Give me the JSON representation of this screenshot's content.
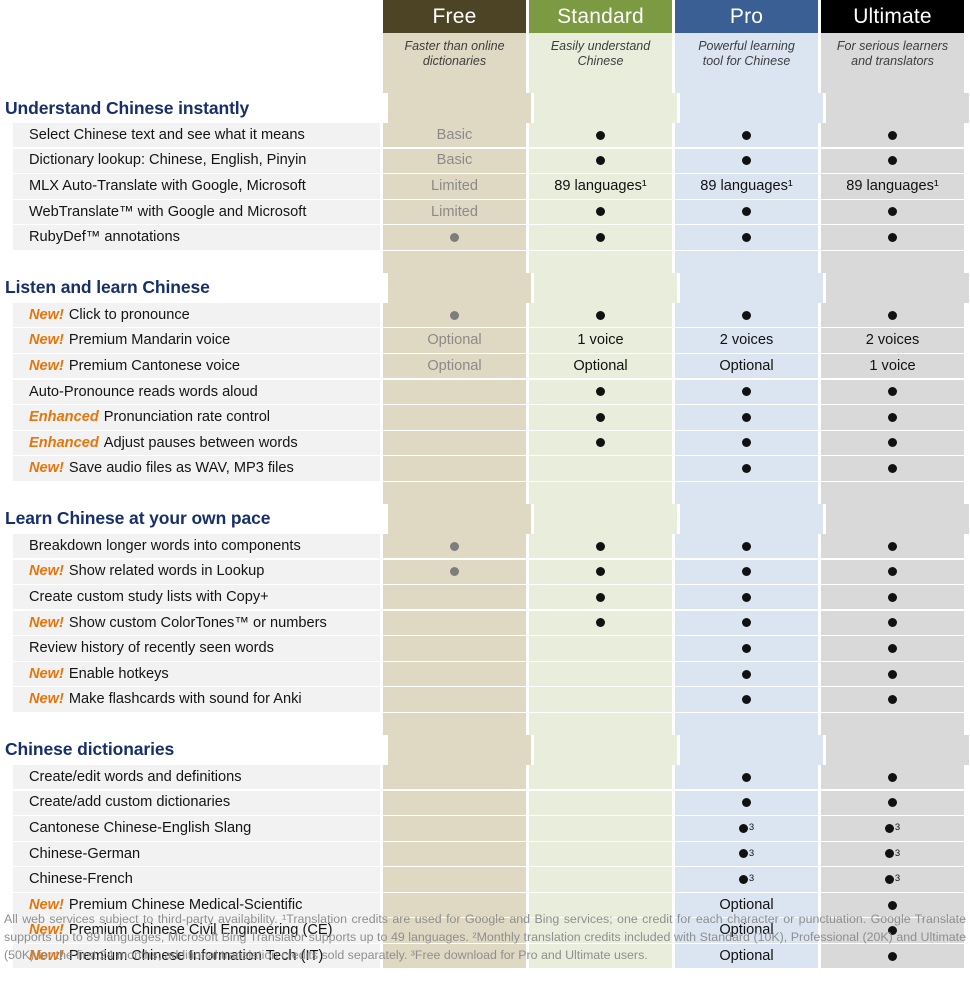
{
  "colors": {
    "free_header": "#4c4425",
    "free_body": "#dfd9c3",
    "standard_header": "#7c9a41",
    "standard_body": "#e9eedc",
    "pro_header": "#3a5f94",
    "pro_body": "#dbe5f1",
    "ultimate_header": "#000000",
    "ultimate_body": "#d9d9d9",
    "section_title": "#17306b",
    "tag_orange": "#e8740c",
    "label_row": "#f2f2f2",
    "dot_dark": "#111111",
    "dot_grey": "#7d7d7d"
  },
  "plans": [
    {
      "name": "Free",
      "tagline_1": "Faster than online",
      "tagline_2": "dictionaries"
    },
    {
      "name": "Standard",
      "tagline_1": "Easily understand",
      "tagline_2": "Chinese"
    },
    {
      "name": "Pro",
      "tagline_1": "Powerful learning",
      "tagline_2": "tool for Chinese"
    },
    {
      "name": "Ultimate",
      "tagline_1": "For serious learners",
      "tagline_2": "and translators"
    }
  ],
  "sections": [
    {
      "title": "Understand Chinese instantly",
      "rows": [
        {
          "tag": "",
          "label": "Select Chinese text and see what it means",
          "values": [
            "Basic",
            "dot",
            "dot",
            "dot"
          ]
        },
        {
          "tag": "",
          "label": "Dictionary lookup: Chinese, English, Pinyin",
          "values": [
            "Basic",
            "dot",
            "dot",
            "dot"
          ]
        },
        {
          "tag": "",
          "label": "MLX Auto-Translate with Google, Microsoft",
          "values": [
            "Limited",
            "89 languages¹",
            "89 languages¹",
            "89 languages¹"
          ]
        },
        {
          "tag": "",
          "label": "WebTranslate™ with Google and Microsoft",
          "values": [
            "Limited",
            "dot",
            "dot",
            "dot"
          ]
        },
        {
          "tag": "",
          "label": "RubyDef™ annotations",
          "values": [
            "dot-grey",
            "dot",
            "dot",
            "dot"
          ]
        }
      ]
    },
    {
      "title": "Listen and learn Chinese",
      "rows": [
        {
          "tag": "New!",
          "label": "Click to pronounce",
          "values": [
            "dot-grey",
            "dot",
            "dot",
            "dot"
          ]
        },
        {
          "tag": "New!",
          "label": "Premium Mandarin voice",
          "values": [
            "Optional",
            "1 voice",
            "2 voices",
            "2 voices"
          ]
        },
        {
          "tag": "New!",
          "label": "Premium Cantonese voice",
          "values": [
            "Optional",
            "Optional",
            "Optional",
            "1 voice"
          ]
        },
        {
          "tag": "",
          "label": "Auto-Pronounce reads words aloud",
          "values": [
            "",
            "dot",
            "dot",
            "dot"
          ]
        },
        {
          "tag": "Enhanced",
          "label": "Pronunciation rate control",
          "values": [
            "",
            "dot",
            "dot",
            "dot"
          ]
        },
        {
          "tag": "Enhanced",
          "label": "Adjust pauses between words",
          "values": [
            "",
            "dot",
            "dot",
            "dot"
          ]
        },
        {
          "tag": "New!",
          "label": "Save audio files as WAV, MP3 files",
          "values": [
            "",
            "",
            "dot",
            "dot"
          ]
        }
      ]
    },
    {
      "title": "Learn Chinese at your own pace",
      "rows": [
        {
          "tag": "",
          "label": "Breakdown longer words into components",
          "values": [
            "dot-grey",
            "dot",
            "dot",
            "dot"
          ]
        },
        {
          "tag": "New!",
          "label": "Show related words in Lookup",
          "values": [
            "dot-grey",
            "dot",
            "dot",
            "dot"
          ]
        },
        {
          "tag": "",
          "label": "Create custom study lists with Copy+",
          "values": [
            "",
            "dot",
            "dot",
            "dot"
          ]
        },
        {
          "tag": "New!",
          "label": "Show custom ColorTones™ or numbers",
          "values": [
            "",
            "dot",
            "dot",
            "dot"
          ]
        },
        {
          "tag": "",
          "label": "Review history of recently seen words",
          "values": [
            "",
            "",
            "dot",
            "dot"
          ]
        },
        {
          "tag": "New!",
          "label": "Enable hotkeys",
          "values": [
            "",
            "",
            "dot",
            "dot"
          ]
        },
        {
          "tag": "New!",
          "label": "Make flashcards with sound for Anki",
          "values": [
            "",
            "",
            "dot",
            "dot"
          ]
        }
      ]
    },
    {
      "title": "Chinese dictionaries",
      "rows": [
        {
          "tag": "",
          "label": "Create/edit words and definitions",
          "values": [
            "",
            "",
            "dot",
            "dot"
          ]
        },
        {
          "tag": "",
          "label": "Create/add custom dictionaries",
          "values": [
            "",
            "",
            "dot",
            "dot"
          ]
        },
        {
          "tag": "",
          "label": "Cantonese Chinese-English Slang",
          "values": [
            "",
            "",
            "dot-sup3",
            "dot-sup3"
          ]
        },
        {
          "tag": "",
          "label": "Chinese-German",
          "values": [
            "",
            "",
            "dot-sup3",
            "dot-sup3"
          ]
        },
        {
          "tag": "",
          "label": "Chinese-French",
          "values": [
            "",
            "",
            "dot-sup3",
            "dot-sup3"
          ]
        },
        {
          "tag": "New!",
          "label": "Premium Chinese Medical-Scientific",
          "values": [
            "",
            "",
            "Optional",
            "dot"
          ]
        },
        {
          "tag": "New!",
          "label": "Premium Chinese Civil Engineering (CE)",
          "values": [
            "",
            "",
            "Optional",
            "dot"
          ]
        },
        {
          "tag": "New!",
          "label": "Premium Chinese Information Tech (IT)",
          "values": [
            "",
            "",
            "Optional",
            "dot"
          ]
        }
      ]
    }
  ],
  "footnote": "All web services subject to third-party availability. ¹Translation credits are used for Google and Bing services; one credit for each character or punctuation. Google Translate supports up to 89 languages, Microsoft Bing Translator supports up to 49 languages. ²Monthly translation credits included with Standard (10K), Professional (20K) and Ultimate (50K) for the first 24 months; additional translation credits sold separately. ³Free download for Pro and Ultimate users."
}
